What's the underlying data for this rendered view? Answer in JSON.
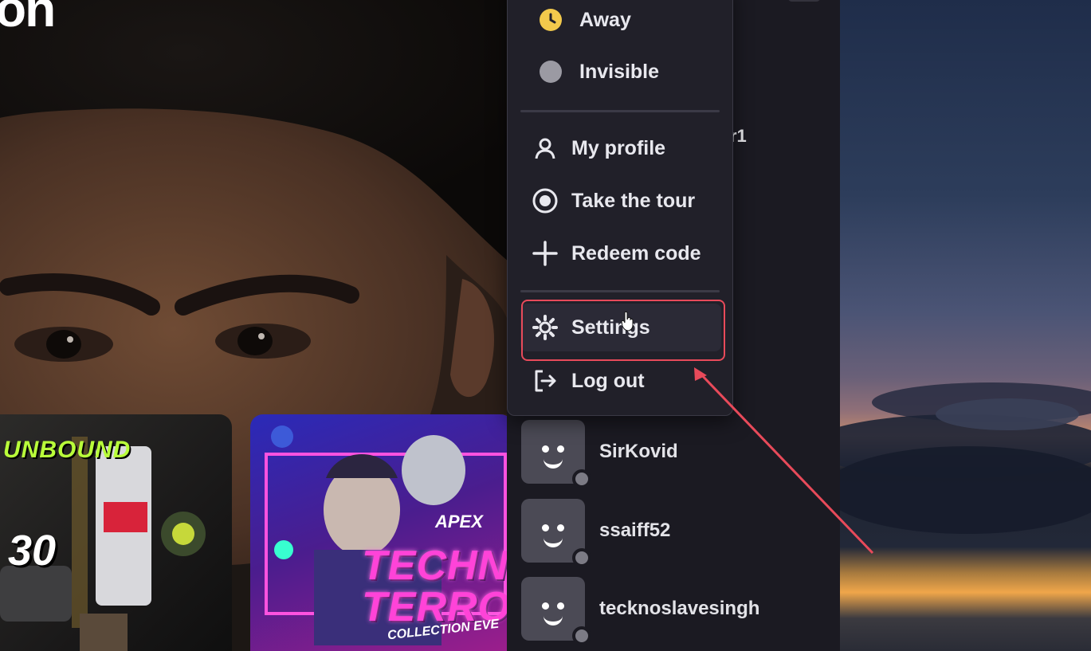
{
  "hero": {
    "logo_fragment": "on",
    "cards": [
      {
        "id": "nfs",
        "title": "UNBOUND",
        "number": "30"
      },
      {
        "id": "apex",
        "brand": "APEX",
        "title_line1": "TECHN",
        "title_line2": "TERRO",
        "subtitle": "COLLECTION EVE"
      }
    ]
  },
  "menu": {
    "status_items": [
      {
        "label": "Away",
        "color": "#f2c94c",
        "icon": "clock-icon"
      },
      {
        "label": "Invisible",
        "color": "#9b9aa3",
        "icon": "invisible-dot-icon"
      }
    ],
    "action_items": [
      {
        "label": "My profile",
        "icon": "person-icon"
      },
      {
        "label": "Take the tour",
        "icon": "target-icon"
      },
      {
        "label": "Redeem code",
        "icon": "plus-icon"
      }
    ],
    "settings_label": "Settings",
    "logout_label": "Log out"
  },
  "friends_fragment": "r1",
  "friends": [
    {
      "name": "SirKovid"
    },
    {
      "name": "ssaiff52"
    },
    {
      "name": "tecknoslavesingh"
    }
  ],
  "annotation": {
    "color": "#e84a5a"
  }
}
